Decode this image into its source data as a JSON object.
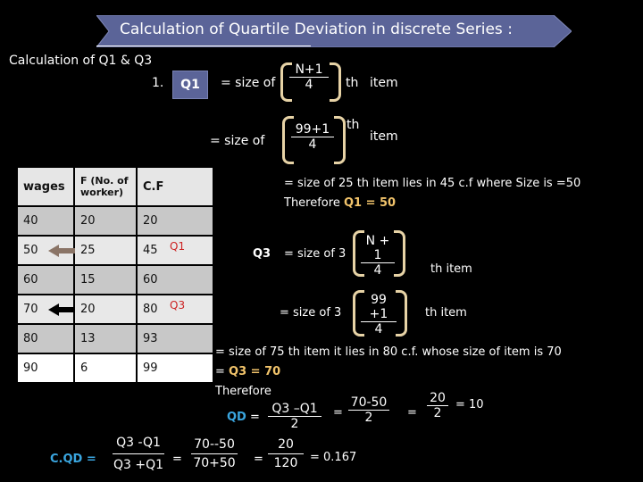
{
  "banner": {
    "title": "Calculation of  Quartile Deviation in discrete Series :"
  },
  "section_heading": "Calculation of Q1 & Q3",
  "q1": {
    "number": "1.",
    "label": "Q1",
    "line1": {
      "prefix": "= size of",
      "numerator": "N+1",
      "denominator": "4",
      "suffix_th": "th",
      "suffix_item": "item"
    },
    "line2": {
      "prefix": "= size of",
      "numerator": "99+1",
      "denominator": "4",
      "suffix_th": "th",
      "suffix_item": "item"
    },
    "result_line": "= size of 25 th item lies in 45 c.f where Size is =50",
    "therefore": "Therefore",
    "result_value": "Q1 = 50"
  },
  "table": {
    "headers": [
      "wages",
      "F (No. of worker)",
      "C.F"
    ],
    "rows": [
      {
        "wages": "40",
        "f": "20",
        "cf": "20",
        "marker": ""
      },
      {
        "wages": "50",
        "f": "25",
        "cf": "45",
        "marker": "Q1"
      },
      {
        "wages": "60",
        "f": "15",
        "cf": "60",
        "marker": ""
      },
      {
        "wages": "70",
        "f": "20",
        "cf": "80",
        "marker": "Q3"
      },
      {
        "wages": "80",
        "f": "13",
        "cf": "93",
        "marker": ""
      },
      {
        "wages": "90",
        "f": "6",
        "cf": "99",
        "marker": ""
      }
    ]
  },
  "q3": {
    "label": "Q3",
    "line1": {
      "prefix": "= size of 3",
      "numerator": "N + 1",
      "denominator": "4",
      "suffix": "th   item"
    },
    "line2": {
      "prefix": "= size of   3",
      "numerator": "99 +1",
      "denominator": "4",
      "suffix": "th   item"
    },
    "result_line": "= size of 75 th item  it lies in 80 c.f. whose size  of item is 70",
    "eq_prefix": "=",
    "result_value": "Q3  = 70"
  },
  "qd": {
    "therefore": "Therefore",
    "label": "QD",
    "equals": "=",
    "frac1": {
      "num": "Q3 –Q1",
      "den": "2"
    },
    "frac2": {
      "num": "70-50",
      "den": "2"
    },
    "frac3": {
      "num": "20",
      "den": "2"
    },
    "result": "= 10"
  },
  "cqd": {
    "label": "C.QD =",
    "frac1": {
      "num": "Q3 -Q1",
      "den": "Q3 +Q1"
    },
    "frac2": {
      "num": "70--50",
      "den": "70+50"
    },
    "frac3": {
      "num": "20",
      "den": "120"
    },
    "equals": "=",
    "result": "= 0.167"
  },
  "colors": {
    "banner": "#5b6498",
    "bracket": "#e7d3a6",
    "highlight": "#f2c46b",
    "qd_blue": "#3aa6e0",
    "marker_red": "#cc2222"
  }
}
